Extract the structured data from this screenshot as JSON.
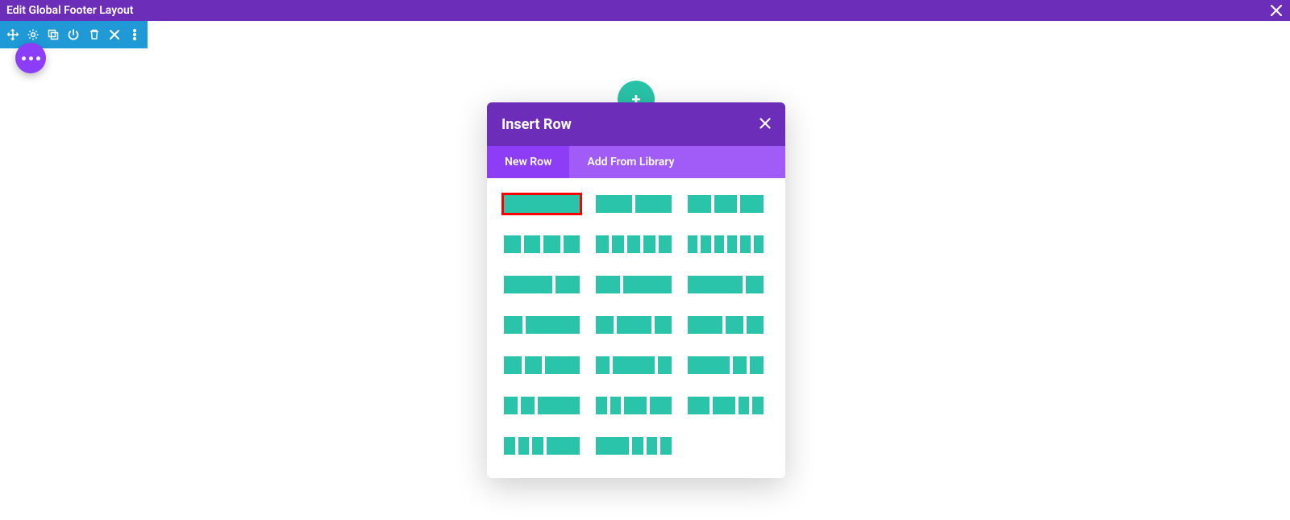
{
  "topbar": {
    "title": "Edit Global Footer Layout"
  },
  "section_toolbar": {
    "icons": [
      "move",
      "settings",
      "duplicate",
      "power",
      "delete",
      "close",
      "more"
    ]
  },
  "fab": {
    "tooltip": "More options"
  },
  "add_button": {
    "label": "+"
  },
  "modal": {
    "title": "Insert Row",
    "tabs": [
      {
        "label": "New Row",
        "active": true
      },
      {
        "label": "Add From Library",
        "active": false
      }
    ],
    "layouts": [
      {
        "cols": [
          1
        ],
        "selected": true
      },
      {
        "cols": [
          1,
          1
        ],
        "selected": false
      },
      {
        "cols": [
          1,
          1,
          1
        ],
        "selected": false
      },
      {
        "cols": [
          1,
          1,
          1,
          1
        ],
        "selected": false
      },
      {
        "cols": [
          1,
          1,
          1,
          1,
          1
        ],
        "selected": false
      },
      {
        "cols": [
          1,
          1,
          1,
          1,
          1,
          1
        ],
        "selected": false
      },
      {
        "cols": [
          2,
          1
        ],
        "selected": false
      },
      {
        "cols": [
          1,
          2
        ],
        "selected": false
      },
      {
        "cols": [
          3,
          1
        ],
        "selected": false
      },
      {
        "cols": [
          1,
          3
        ],
        "selected": false
      },
      {
        "cols": [
          1,
          2,
          1
        ],
        "selected": false
      },
      {
        "cols": [
          2,
          1,
          1
        ],
        "selected": false
      },
      {
        "cols": [
          1,
          1,
          2
        ],
        "selected": false
      },
      {
        "cols": [
          1,
          3,
          1
        ],
        "selected": false
      },
      {
        "cols": [
          3,
          1,
          1
        ],
        "selected": false
      },
      {
        "cols": [
          1,
          1,
          3
        ],
        "selected": false
      },
      {
        "cols": [
          1,
          1,
          2,
          2
        ],
        "selected": false
      },
      {
        "cols": [
          2,
          2,
          1,
          1
        ],
        "selected": false
      },
      {
        "cols": [
          1,
          1,
          1,
          3
        ],
        "selected": false
      },
      {
        "cols": [
          3,
          1,
          1,
          1
        ],
        "selected": false
      }
    ]
  }
}
